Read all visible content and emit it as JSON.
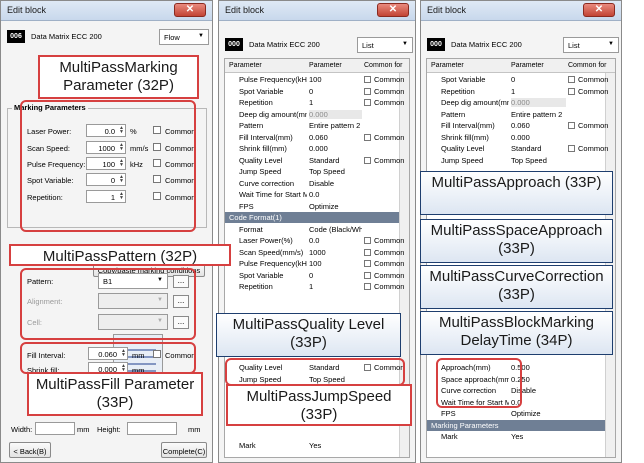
{
  "left_panel": {
    "title": "Edit block",
    "close_label": "✕",
    "tag": "006",
    "barcode": "Data Matrix ECC 200",
    "mode": "Flow",
    "marking_group": "Marking Parameters",
    "fields": [
      {
        "label": "Laser Power:",
        "value": "0.0",
        "unit": "%",
        "common": "Common"
      },
      {
        "label": "Scan Speed:",
        "value": "1000",
        "unit": "mm/s",
        "common": "Common"
      },
      {
        "label": "Pulse Frequency:",
        "value": "100",
        "unit": "kHz",
        "common": "Common"
      },
      {
        "label": "Spot Variable:",
        "value": "0",
        "unit": "",
        "common": "Common"
      },
      {
        "label": "Repetition:",
        "value": "1",
        "unit": "",
        "common": "Common"
      }
    ],
    "copy_button": "Copy/paste marking conditions",
    "pattern_label": "Pattern:",
    "pattern_value": "B1",
    "alignment_label": "Alignment:",
    "cell_label": "Cell:",
    "ellipsis": "...",
    "fill_interval_label": "Fill Interval:",
    "fill_interval_value": "0.060",
    "fill_interval_unit": "mm",
    "fill_interval_common": "Common",
    "shrink_label": "Shrink fill:",
    "shrink_value": "0.000",
    "shrink_unit": "mm",
    "width_label": "Width:",
    "width_unit": "mm",
    "height_label": "Height:",
    "height_unit": "mm",
    "back_button": "< Back(B)",
    "complete_button": "Complete(C)"
  },
  "middle_panel": {
    "title": "Edit block",
    "close_label": "✕",
    "tag": "000",
    "barcode": "Data Matrix ECC 200",
    "mode": "List",
    "headers": [
      "Parameter",
      "Parameter",
      "Common for"
    ],
    "rows_top": [
      {
        "name": "Pulse Frequency(kHz",
        "value": "100",
        "common": "Common"
      },
      {
        "name": "Spot Variable",
        "value": "0",
        "common": "Common"
      },
      {
        "name": "Repetition",
        "value": "1",
        "common": "Common"
      },
      {
        "name": "Deep dig amount(mm",
        "value": "0.000",
        "common": "",
        "disabled": true
      },
      {
        "name": "Pattern",
        "value": "Entire pattern 2",
        "common": ""
      },
      {
        "name": "Fill Interval(mm)",
        "value": "0.060",
        "common": "Common"
      },
      {
        "name": "Shrink fill(mm)",
        "value": "0.000",
        "common": ""
      },
      {
        "name": "Quality Level",
        "value": "Standard",
        "common": "Common"
      },
      {
        "name": "Jump Speed",
        "value": "Top Speed",
        "common": ""
      },
      {
        "name": "Curve correction",
        "value": "Disable",
        "common": ""
      },
      {
        "name": "Wait Time for Start M",
        "value": "0.0",
        "common": ""
      },
      {
        "name": "FPS",
        "value": "Optimize",
        "common": ""
      }
    ],
    "section_code": "Code Format(1)",
    "rows_code": [
      {
        "name": "Format",
        "value": "Code (Black/Whit",
        "common": ""
      },
      {
        "name": "Laser Power(%)",
        "value": "0.0",
        "common": "Common"
      },
      {
        "name": "Scan Speed(mm/s)",
        "value": "1000",
        "common": "Common"
      },
      {
        "name": "Pulse Frequency(kHz",
        "value": "100",
        "common": "Common"
      },
      {
        "name": "Spot Variable",
        "value": "0",
        "common": "Common"
      },
      {
        "name": "Repetition",
        "value": "1",
        "common": "Common"
      }
    ],
    "rows_bottom": [
      {
        "name": "Quality Level",
        "value": "Standard",
        "common": "Common"
      },
      {
        "name": "Jump Speed",
        "value": "Top Speed",
        "common": ""
      }
    ],
    "row_mark": {
      "name": "Mark",
      "value": "Yes"
    }
  },
  "right_panel": {
    "title": "Edit block",
    "close_label": "✕",
    "tag": "000",
    "barcode": "Data Matrix ECC 200",
    "mode": "List",
    "headers": [
      "Parameter",
      "Parameter",
      "Common for"
    ],
    "rows_top": [
      {
        "name": "Spot Variable",
        "value": "0",
        "common": "Common"
      },
      {
        "name": "Repetition",
        "value": "1",
        "common": "Common"
      },
      {
        "name": "Deep dig amount(mm",
        "value": "0.000",
        "common": "",
        "disabled": true
      },
      {
        "name": "Pattern",
        "value": "Entire pattern 2",
        "common": ""
      },
      {
        "name": "Fill Interval(mm)",
        "value": "0.060",
        "common": "Common"
      },
      {
        "name": "Shrink fill(mm)",
        "value": "0.000",
        "common": ""
      },
      {
        "name": "Quality Level",
        "value": "Standard",
        "common": "Common"
      },
      {
        "name": "Jump Speed",
        "value": "Top Speed",
        "common": ""
      }
    ],
    "rows_bottom": [
      {
        "name": "Approach(mm)",
        "value": "0.500"
      },
      {
        "name": "Space approach(mm",
        "value": "0.250"
      },
      {
        "name": "Curve correction",
        "value": "Disable"
      },
      {
        "name": "Wait Time for Start M",
        "value": "0.0"
      },
      {
        "name": "FPS",
        "value": "Optimize"
      }
    ],
    "section_marking": "Marking Parameters",
    "row_mark": {
      "name": "Mark",
      "value": "Yes"
    }
  },
  "callouts": {
    "marking": "MultiPassMarking Parameter (32P)",
    "pattern": "MultiPassPattern (32P)",
    "fill": "MultiPassFill Parameter (33P)",
    "quality": "MultiPassQuality Level (33P)",
    "jump": "MultiPassJumpSpeed (33P)",
    "approach": "MultiPassApproach (33P)",
    "space": "MultiPassSpaceApproach (33P)",
    "curve": "MultiPassCurveCorrection (33P)",
    "delay": "MultiPassBlockMarking DelayTime (34P)"
  }
}
